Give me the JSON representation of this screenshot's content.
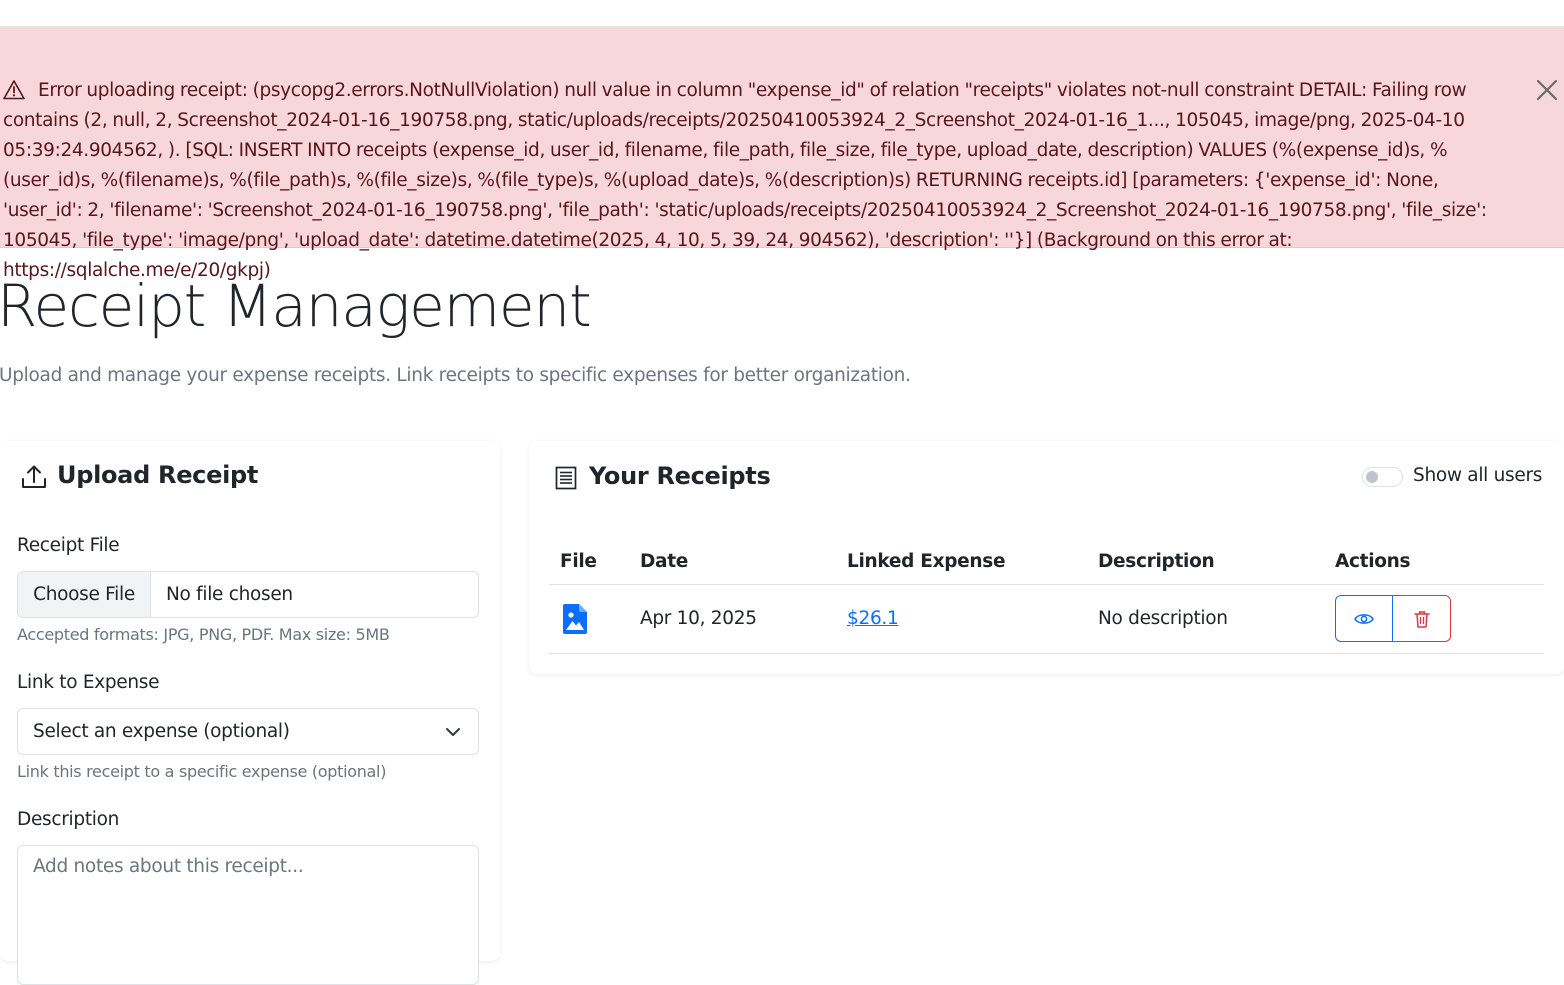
{
  "alert": {
    "message": "Error uploading receipt: (psycopg2.errors.NotNullViolation) null value in column \"expense_id\" of relation \"receipts\" violates not-null constraint DETAIL: Failing row contains (2, null, 2, Screenshot_2024-01-16_190758.png, static/uploads/receipts/20250410053924_2_Screenshot_2024-01-16_1..., 105045, image/png, 2025-04-10 05:39:24.904562, ). [SQL: INSERT INTO receipts (expense_id, user_id, filename, file_path, file_size, file_type, upload_date, description) VALUES (%(expense_id)s, %(user_id)s, %(filename)s, %(file_path)s, %(file_size)s, %(file_type)s, %(upload_date)s, %(description)s) RETURNING receipts.id] [parameters: {'expense_id': None, 'user_id': 2, 'filename': 'Screenshot_2024-01-16_190758.png', 'file_path': 'static/uploads/receipts/20250410053924_2_Screenshot_2024-01-16_190758.png', 'file_size': 105045, 'file_type': 'image/png', 'upload_date': datetime.datetime(2025, 4, 10, 5, 39, 24, 904562), 'description': ''}] (Background on this error at: https://sqlalche.me/e/20/gkpj)",
    "icon": "warning-triangle-icon",
    "close_icon": "close-icon"
  },
  "page": {
    "title": "Receipt Management",
    "lead": "Upload and manage your expense receipts. Link receipts to specific expenses for better organization."
  },
  "upload": {
    "title": "Upload Receipt",
    "icon": "upload-icon",
    "file_label": "Receipt File",
    "file_button": "Choose File",
    "file_status": "No file chosen",
    "file_help": "Accepted formats: JPG, PNG, PDF. Max size: 5MB",
    "expense_label": "Link to Expense",
    "expense_selected": "Select an expense (optional)",
    "expense_help": "Link this receipt to a specific expense (optional)",
    "description_label": "Description",
    "description_placeholder": "Add notes about this receipt..."
  },
  "receipts": {
    "title": "Your Receipts",
    "icon": "receipt-icon",
    "toggle_label": "Show all users",
    "toggle_on": false,
    "columns": [
      "File",
      "Date",
      "Linked Expense",
      "Description",
      "Actions"
    ],
    "rows": [
      {
        "file_icon": "image-file-icon",
        "date": "Apr 10, 2025",
        "expense": "$26.1",
        "description": "No description",
        "view_icon": "eye-icon",
        "delete_icon": "trash-icon"
      }
    ]
  },
  "colors": {
    "alert_bg": "#f8d7da",
    "alert_text": "#58151c",
    "primary": "#0d6efd",
    "danger": "#dc3545",
    "muted": "#6c757d"
  }
}
